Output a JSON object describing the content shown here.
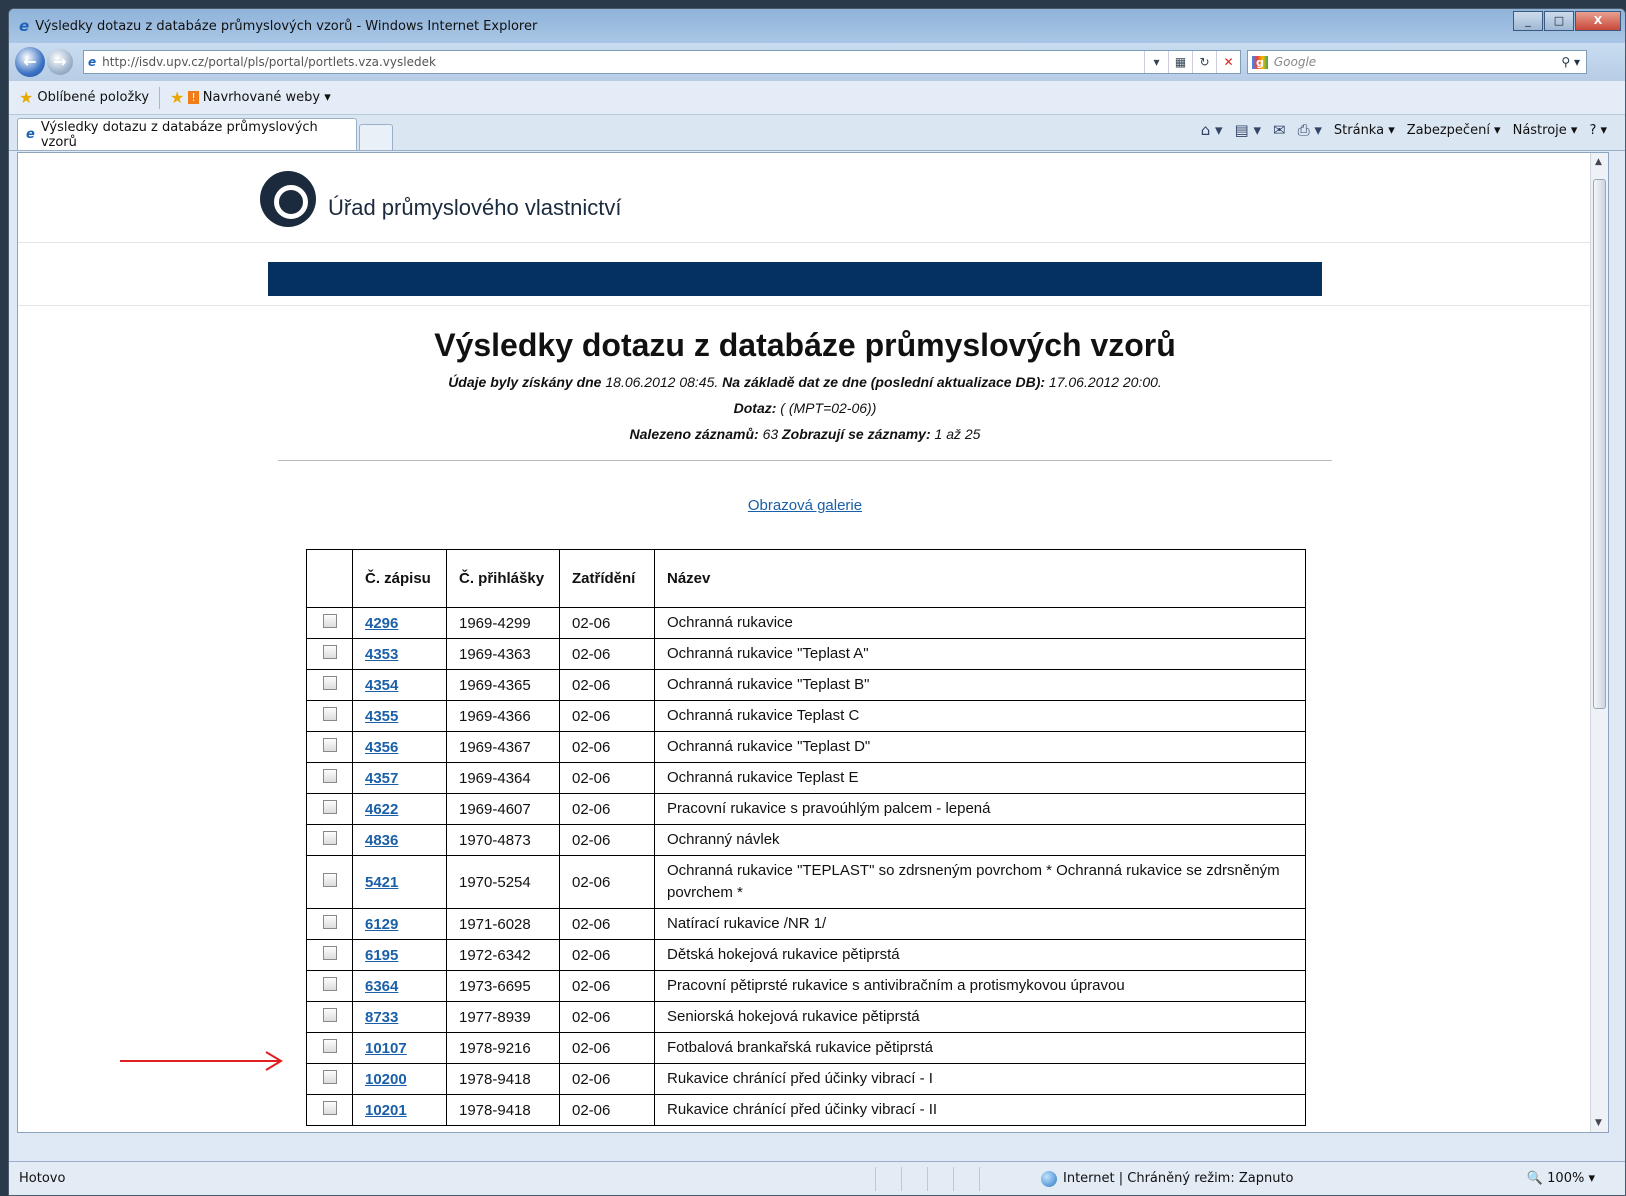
{
  "window": {
    "title": "Výsledky dotazu z databáze průmyslových vzorů - Windows Internet Explorer",
    "controls": {
      "minimize": "_",
      "maximize": "□",
      "close": "X"
    }
  },
  "navbar": {
    "back_icon": "back-arrow-icon",
    "forward_icon": "forward-arrow-icon",
    "url": "http://isdv.upv.cz/portal/pls/portal/portlets.vza.vysledek",
    "search_engine": "Google",
    "search_placeholder": "Google"
  },
  "favorites": {
    "favorites_label": "Oblíbené položky",
    "suggested_label": "Navrhované weby ▾"
  },
  "tabs": [
    {
      "label": "Výsledky dotazu z databáze průmyslových vzorů"
    }
  ],
  "commandbar": {
    "page": "Stránka ▾",
    "security": "Zabezpečení ▾",
    "tools": "Nástroje ▾",
    "help": "? ▾"
  },
  "site": {
    "org_name": "Úřad průmyslového vlastnictví"
  },
  "page": {
    "title": "Výsledky dotazu z databáze průmyslových vzorů",
    "retrieved_label": "Údaje byly získány dne",
    "retrieved_value": "18.06.2012 08:45.",
    "basis_label": "Na základě dat ze dne (poslední aktualizace DB):",
    "basis_value": "17.06.2012 20:00.",
    "query_label": "Dotaz:",
    "query_value": "( (MPT=02-06))",
    "found_label": "Nalezeno záznamů:",
    "found_value": "63",
    "showing_label": "Zobrazují se záznamy:",
    "showing_value": "1 až 25",
    "gallery_link": "Obrazová galerie"
  },
  "table": {
    "headers": {
      "reg_no": "Č. zápisu",
      "app_no": "Č. přihlášky",
      "class": "Zatřídění",
      "name": "Název"
    },
    "rows": [
      {
        "reg": "4296",
        "app": "1969-4299",
        "cls": "02-06",
        "name": "Ochranná rukavice"
      },
      {
        "reg": "4353",
        "app": "1969-4363",
        "cls": "02-06",
        "name": "Ochranná rukavice \"Teplast A\""
      },
      {
        "reg": "4354",
        "app": "1969-4365",
        "cls": "02-06",
        "name": "Ochranná rukavice \"Teplast B\""
      },
      {
        "reg": "4355",
        "app": "1969-4366",
        "cls": "02-06",
        "name": "Ochranná rukavice Teplast C"
      },
      {
        "reg": "4356",
        "app": "1969-4367",
        "cls": "02-06",
        "name": "Ochranná rukavice \"Teplast D\""
      },
      {
        "reg": "4357",
        "app": "1969-4364",
        "cls": "02-06",
        "name": "Ochranná rukavice Teplast E"
      },
      {
        "reg": "4622",
        "app": "1969-4607",
        "cls": "02-06",
        "name": "Pracovní rukavice s pravoúhlým palcem - lepená"
      },
      {
        "reg": "4836",
        "app": "1970-4873",
        "cls": "02-06",
        "name": "Ochranný návlek"
      },
      {
        "reg": "5421",
        "app": "1970-5254",
        "cls": "02-06",
        "name": "Ochranná rukavice \"TEPLAST\" so zdrsneným povrchom * Ochranná rukavice se zdrsněným povrchem *"
      },
      {
        "reg": "6129",
        "app": "1971-6028",
        "cls": "02-06",
        "name": "Natírací rukavice /NR 1/"
      },
      {
        "reg": "6195",
        "app": "1972-6342",
        "cls": "02-06",
        "name": "Dětská hokejová rukavice pětiprstá"
      },
      {
        "reg": "6364",
        "app": "1973-6695",
        "cls": "02-06",
        "name": "Pracovní pětiprsté rukavice s antivibračním a protismykovou úpravou"
      },
      {
        "reg": "8733",
        "app": "1977-8939",
        "cls": "02-06",
        "name": "Seniorská hokejová rukavice pětiprstá"
      },
      {
        "reg": "10107",
        "app": "1978-9216",
        "cls": "02-06",
        "name": "Fotbalová brankařská rukavice pětiprstá"
      },
      {
        "reg": "10200",
        "app": "1978-9418",
        "cls": "02-06",
        "name": "Rukavice chránící před účinky vibrací - I"
      },
      {
        "reg": "10201",
        "app": "1978-9418",
        "cls": "02-06",
        "name": "Rukavice chránící před účinky vibrací - II"
      }
    ]
  },
  "annotation": {
    "arrow_color": "#e02020"
  },
  "statusbar": {
    "left": "Hotovo",
    "zone": "Internet | Chráněný režim: Zapnuto",
    "zoom": "100%"
  },
  "colors": {
    "header_bar": "#053160",
    "link": "#1a5fa8"
  }
}
